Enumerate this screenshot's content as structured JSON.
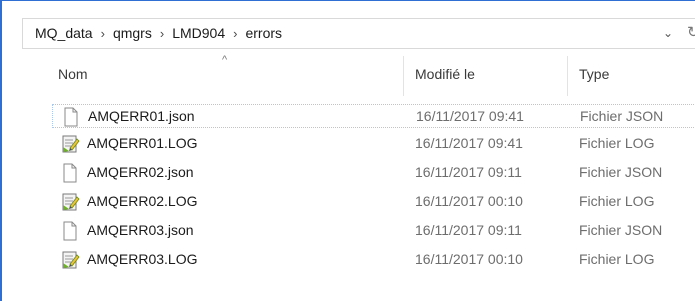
{
  "breadcrumb": {
    "items": [
      "MQ_data",
      "qmgrs",
      "LMD904",
      "errors"
    ],
    "separator": "›"
  },
  "columns": {
    "name": "Nom",
    "modified": "Modifié le",
    "type": "Type",
    "sort_indicator": "^"
  },
  "files": [
    {
      "name": "AMQERR01.json",
      "modified": "16/11/2017 09:41",
      "type": "Fichier JSON",
      "icon": "blank-document-icon"
    },
    {
      "name": "AMQERR01.LOG",
      "modified": "16/11/2017 09:41",
      "type": "Fichier LOG",
      "icon": "text-document-icon"
    },
    {
      "name": "AMQERR02.json",
      "modified": "16/11/2017 09:11",
      "type": "Fichier JSON",
      "icon": "blank-document-icon"
    },
    {
      "name": "AMQERR02.LOG",
      "modified": "16/11/2017 00:10",
      "type": "Fichier LOG",
      "icon": "text-document-icon"
    },
    {
      "name": "AMQERR03.json",
      "modified": "16/11/2017 09:11",
      "type": "Fichier JSON",
      "icon": "blank-document-icon"
    },
    {
      "name": "AMQERR03.LOG",
      "modified": "16/11/2017 00:10",
      "type": "Fichier LOG",
      "icon": "text-document-icon"
    }
  ],
  "colors": {
    "accent": "#2f6fd3",
    "selection_border": "#a8c8ee"
  }
}
